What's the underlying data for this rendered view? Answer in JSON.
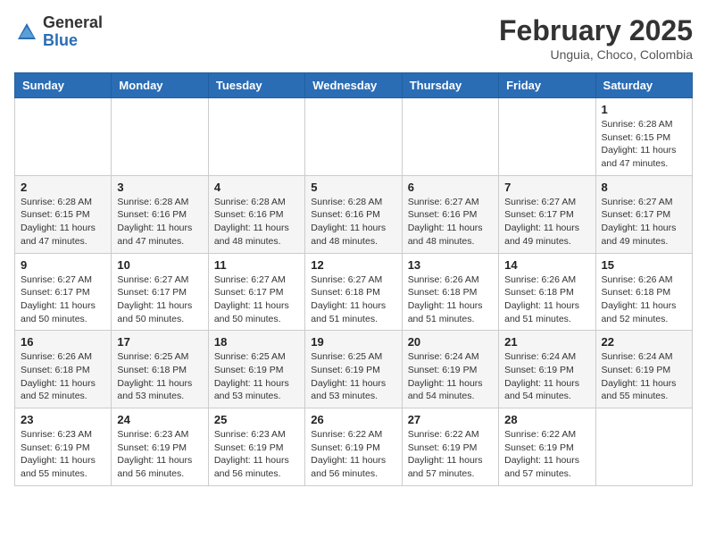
{
  "logo": {
    "general": "General",
    "blue": "Blue"
  },
  "title": {
    "month_year": "February 2025",
    "location": "Unguia, Choco, Colombia"
  },
  "weekdays": [
    "Sunday",
    "Monday",
    "Tuesday",
    "Wednesday",
    "Thursday",
    "Friday",
    "Saturday"
  ],
  "weeks": [
    [
      {
        "day": "",
        "info": ""
      },
      {
        "day": "",
        "info": ""
      },
      {
        "day": "",
        "info": ""
      },
      {
        "day": "",
        "info": ""
      },
      {
        "day": "",
        "info": ""
      },
      {
        "day": "",
        "info": ""
      },
      {
        "day": "1",
        "info": "Sunrise: 6:28 AM\nSunset: 6:15 PM\nDaylight: 11 hours\nand 47 minutes."
      }
    ],
    [
      {
        "day": "2",
        "info": "Sunrise: 6:28 AM\nSunset: 6:15 PM\nDaylight: 11 hours\nand 47 minutes."
      },
      {
        "day": "3",
        "info": "Sunrise: 6:28 AM\nSunset: 6:16 PM\nDaylight: 11 hours\nand 47 minutes."
      },
      {
        "day": "4",
        "info": "Sunrise: 6:28 AM\nSunset: 6:16 PM\nDaylight: 11 hours\nand 48 minutes."
      },
      {
        "day": "5",
        "info": "Sunrise: 6:28 AM\nSunset: 6:16 PM\nDaylight: 11 hours\nand 48 minutes."
      },
      {
        "day": "6",
        "info": "Sunrise: 6:27 AM\nSunset: 6:16 PM\nDaylight: 11 hours\nand 48 minutes."
      },
      {
        "day": "7",
        "info": "Sunrise: 6:27 AM\nSunset: 6:17 PM\nDaylight: 11 hours\nand 49 minutes."
      },
      {
        "day": "8",
        "info": "Sunrise: 6:27 AM\nSunset: 6:17 PM\nDaylight: 11 hours\nand 49 minutes."
      }
    ],
    [
      {
        "day": "9",
        "info": "Sunrise: 6:27 AM\nSunset: 6:17 PM\nDaylight: 11 hours\nand 50 minutes."
      },
      {
        "day": "10",
        "info": "Sunrise: 6:27 AM\nSunset: 6:17 PM\nDaylight: 11 hours\nand 50 minutes."
      },
      {
        "day": "11",
        "info": "Sunrise: 6:27 AM\nSunset: 6:17 PM\nDaylight: 11 hours\nand 50 minutes."
      },
      {
        "day": "12",
        "info": "Sunrise: 6:27 AM\nSunset: 6:18 PM\nDaylight: 11 hours\nand 51 minutes."
      },
      {
        "day": "13",
        "info": "Sunrise: 6:26 AM\nSunset: 6:18 PM\nDaylight: 11 hours\nand 51 minutes."
      },
      {
        "day": "14",
        "info": "Sunrise: 6:26 AM\nSunset: 6:18 PM\nDaylight: 11 hours\nand 51 minutes."
      },
      {
        "day": "15",
        "info": "Sunrise: 6:26 AM\nSunset: 6:18 PM\nDaylight: 11 hours\nand 52 minutes."
      }
    ],
    [
      {
        "day": "16",
        "info": "Sunrise: 6:26 AM\nSunset: 6:18 PM\nDaylight: 11 hours\nand 52 minutes."
      },
      {
        "day": "17",
        "info": "Sunrise: 6:25 AM\nSunset: 6:18 PM\nDaylight: 11 hours\nand 53 minutes."
      },
      {
        "day": "18",
        "info": "Sunrise: 6:25 AM\nSunset: 6:19 PM\nDaylight: 11 hours\nand 53 minutes."
      },
      {
        "day": "19",
        "info": "Sunrise: 6:25 AM\nSunset: 6:19 PM\nDaylight: 11 hours\nand 53 minutes."
      },
      {
        "day": "20",
        "info": "Sunrise: 6:24 AM\nSunset: 6:19 PM\nDaylight: 11 hours\nand 54 minutes."
      },
      {
        "day": "21",
        "info": "Sunrise: 6:24 AM\nSunset: 6:19 PM\nDaylight: 11 hours\nand 54 minutes."
      },
      {
        "day": "22",
        "info": "Sunrise: 6:24 AM\nSunset: 6:19 PM\nDaylight: 11 hours\nand 55 minutes."
      }
    ],
    [
      {
        "day": "23",
        "info": "Sunrise: 6:23 AM\nSunset: 6:19 PM\nDaylight: 11 hours\nand 55 minutes."
      },
      {
        "day": "24",
        "info": "Sunrise: 6:23 AM\nSunset: 6:19 PM\nDaylight: 11 hours\nand 56 minutes."
      },
      {
        "day": "25",
        "info": "Sunrise: 6:23 AM\nSunset: 6:19 PM\nDaylight: 11 hours\nand 56 minutes."
      },
      {
        "day": "26",
        "info": "Sunrise: 6:22 AM\nSunset: 6:19 PM\nDaylight: 11 hours\nand 56 minutes."
      },
      {
        "day": "27",
        "info": "Sunrise: 6:22 AM\nSunset: 6:19 PM\nDaylight: 11 hours\nand 57 minutes."
      },
      {
        "day": "28",
        "info": "Sunrise: 6:22 AM\nSunset: 6:19 PM\nDaylight: 11 hours\nand 57 minutes."
      },
      {
        "day": "",
        "info": ""
      }
    ]
  ]
}
